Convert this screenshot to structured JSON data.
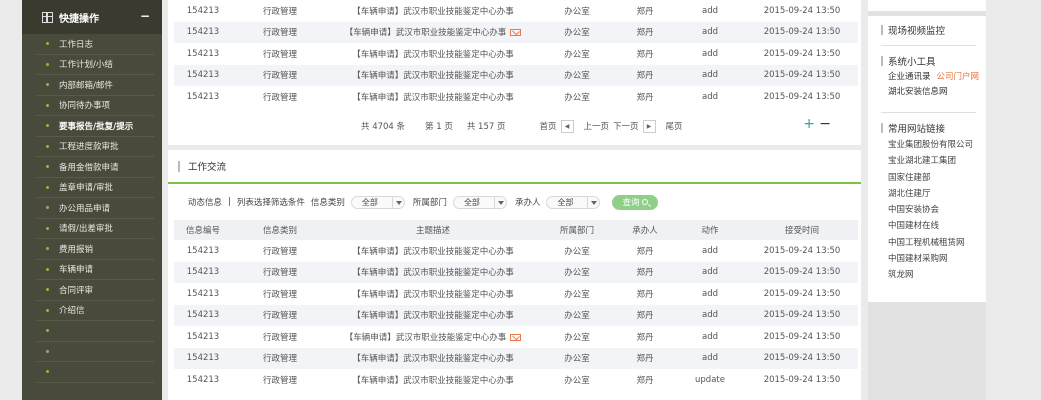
{
  "sidebar": {
    "title": "快捷操作",
    "collapse": "−",
    "items": [
      {
        "label": "工作日志",
        "active": false
      },
      {
        "label": "工作计划/小结",
        "active": false
      },
      {
        "label": "内部邮箱/邮件",
        "active": false
      },
      {
        "label": "协同待办事项",
        "active": false
      },
      {
        "label": "要事报告/批复/提示",
        "active": true
      },
      {
        "label": "工程进度款审批",
        "active": false
      },
      {
        "label": "备用金借款申请",
        "active": false
      },
      {
        "label": "盖章申请/审批",
        "active": false
      },
      {
        "label": "办公用品申请",
        "active": false
      },
      {
        "label": "请假/出差审批",
        "active": false
      },
      {
        "label": "费用报销",
        "active": false
      },
      {
        "label": "车辆申请",
        "active": false
      },
      {
        "label": "合同评审",
        "active": false
      },
      {
        "label": "介绍信",
        "active": false
      },
      {
        "label": "",
        "active": false
      },
      {
        "label": "",
        "active": false
      },
      {
        "label": "",
        "active": false
      }
    ]
  },
  "top_table": {
    "rows": [
      {
        "id": "154213",
        "type": "行政管理",
        "subject": "【车辆申请】武汉市职业技能鉴定中心办事",
        "mail": false,
        "dept": "办公室",
        "user": "郑丹",
        "action": "add",
        "time": "2015-09-24 13:50"
      },
      {
        "id": "154213",
        "type": "行政管理",
        "subject": "【车辆申请】武汉市职业技能鉴定中心办事",
        "mail": true,
        "dept": "办公室",
        "user": "郑丹",
        "action": "add",
        "time": "2015-09-24 13:50"
      },
      {
        "id": "154213",
        "type": "行政管理",
        "subject": "【车辆申请】武汉市职业技能鉴定中心办事",
        "mail": false,
        "dept": "办公室",
        "user": "郑丹",
        "action": "add",
        "time": "2015-09-24 13:50"
      },
      {
        "id": "154213",
        "type": "行政管理",
        "subject": "【车辆申请】武汉市职业技能鉴定中心办事",
        "mail": false,
        "dept": "办公室",
        "user": "郑丹",
        "action": "add",
        "time": "2015-09-24 13:50"
      },
      {
        "id": "154213",
        "type": "行政管理",
        "subject": "【车辆申请】武汉市职业技能鉴定中心办事",
        "mail": false,
        "dept": "办公室",
        "user": "郑丹",
        "action": "add",
        "time": "2015-09-24 13:50"
      }
    ],
    "pager": {
      "total": "共 4704 条",
      "current": "第 1 页",
      "pages": "共 157 页",
      "first": "首页",
      "prev": "上一页",
      "next": "下一页",
      "last": "尾页",
      "prev_arrow": "◀",
      "next_arrow": "▶",
      "plus": "+",
      "minus": "−"
    }
  },
  "exchange": {
    "title": "工作交流",
    "filters": {
      "dynamic": "动态信息",
      "sep": "|",
      "hint": "列表选择筛选条件",
      "type_label": "信息类别",
      "type_value": "全部",
      "dept_label": "所属部门",
      "dept_value": "全部",
      "user_label": "承办人",
      "user_value": "全部",
      "query": "查询"
    },
    "headers": [
      "信息编号",
      "信息类别",
      "主题描述",
      "所属部门",
      "承办人",
      "动作",
      "接受时间"
    ],
    "rows": [
      {
        "id": "154213",
        "type": "行政管理",
        "subject": "【车辆申请】武汉市职业技能鉴定中心办事",
        "mail": false,
        "dept": "办公室",
        "user": "郑丹",
        "action": "add",
        "time": "2015-09-24 13:50"
      },
      {
        "id": "154213",
        "type": "行政管理",
        "subject": "【车辆申请】武汉市职业技能鉴定中心办事",
        "mail": false,
        "dept": "办公室",
        "user": "郑丹",
        "action": "add",
        "time": "2015-09-24 13:50"
      },
      {
        "id": "154213",
        "type": "行政管理",
        "subject": "【车辆申请】武汉市职业技能鉴定中心办事",
        "mail": false,
        "dept": "办公室",
        "user": "郑丹",
        "action": "add",
        "time": "2015-09-24 13:50"
      },
      {
        "id": "154213",
        "type": "行政管理",
        "subject": "【车辆申请】武汉市职业技能鉴定中心办事",
        "mail": false,
        "dept": "办公室",
        "user": "郑丹",
        "action": "add",
        "time": "2015-09-24 13:50"
      },
      {
        "id": "154213",
        "type": "行政管理",
        "subject": "【车辆申请】武汉市职业技能鉴定中心办事",
        "mail": true,
        "dept": "办公室",
        "user": "郑丹",
        "action": "add",
        "time": "2015-09-24 13:50"
      },
      {
        "id": "154213",
        "type": "行政管理",
        "subject": "【车辆申请】武汉市职业技能鉴定中心办事",
        "mail": false,
        "dept": "办公室",
        "user": "郑丹",
        "action": "add",
        "time": "2015-09-24 13:50"
      },
      {
        "id": "154213",
        "type": "行政管理",
        "subject": "【车辆申请】武汉市职业技能鉴定中心办事",
        "mail": false,
        "dept": "办公室",
        "user": "郑丹",
        "action": "update",
        "time": "2015-09-24 13:50"
      }
    ]
  },
  "right": {
    "video_title": "现场视频监控",
    "tools_title": "系统小工具",
    "tools": [
      {
        "label": "企业通讯录"
      },
      {
        "label": "公司门户网"
      }
    ],
    "tool_extra": "湖北安装信息网",
    "links_title": "常用网站链接",
    "links": [
      "宝业集团股份有限公司",
      "宝业湖北建工集团",
      "国家住建部",
      "湖北住建厅",
      "中国安装协会",
      "中国建材在线",
      "中国工程机械租赁网",
      "中国建材采购网",
      "筑龙网"
    ]
  },
  "colors": {
    "sidebar_bg": "#4a4a3c",
    "accent_green": "#7dc142",
    "link_orange": "#e8743b",
    "query_btn": "#8fcf8a"
  }
}
